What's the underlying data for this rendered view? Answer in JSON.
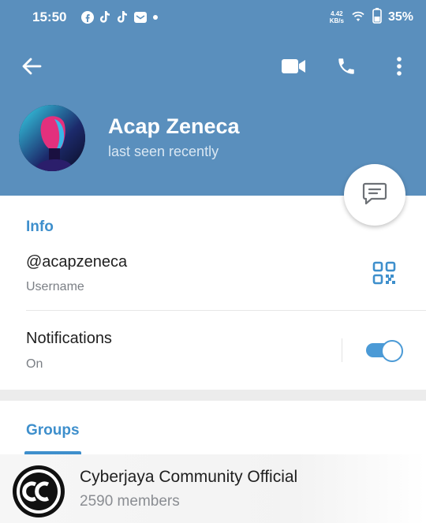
{
  "status_bar": {
    "time": "15:50",
    "network_speed_value": "4.42",
    "network_speed_unit": "KB/s",
    "battery_percent": "35%",
    "notification_icons": [
      "facebook-icon",
      "tiktok-icon",
      "tiktok-icon",
      "mail-icon",
      "dot-icon"
    ]
  },
  "toolbar": {
    "icons": [
      "back-arrow-icon",
      "video-call-icon",
      "phone-icon",
      "more-vertical-icon"
    ]
  },
  "profile": {
    "name": "Acap Zeneca",
    "status": "last seen recently"
  },
  "info": {
    "section_title": "Info",
    "username": "@acapzeneca",
    "username_label": "Username",
    "notifications_label": "Notifications",
    "notifications_value": "On",
    "notifications_enabled": true
  },
  "groups": {
    "section_title": "Groups",
    "items": [
      {
        "name": "Cyberjaya Community Official",
        "members": "2590 members"
      }
    ]
  },
  "colors": {
    "header": "#5a8fbd",
    "accent": "#3e8fcc",
    "toggle": "#4b9ad6"
  }
}
